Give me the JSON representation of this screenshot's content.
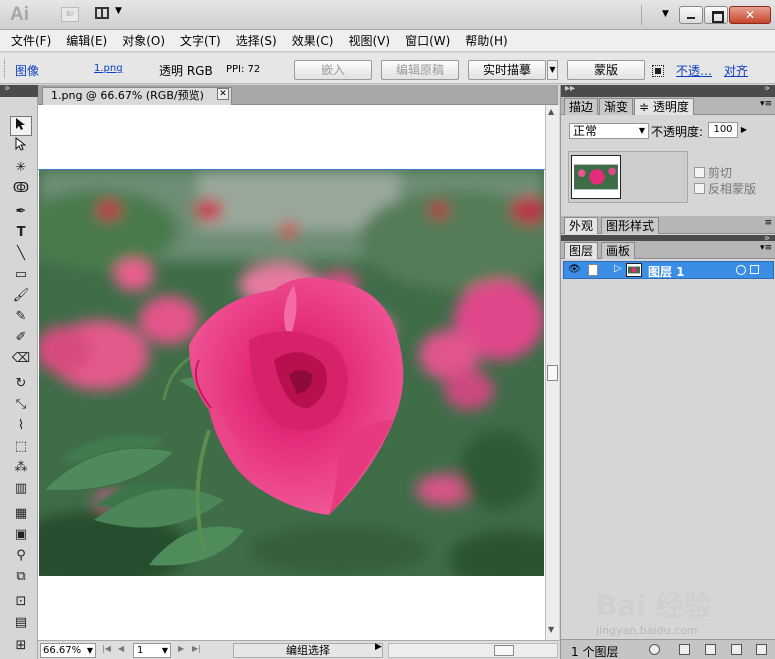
{
  "titlebar": {
    "app_logo": "Ai",
    "bridge": "Br",
    "close": "✕"
  },
  "menu": [
    "文件(F)",
    "编辑(E)",
    "对象(O)",
    "文字(T)",
    "选择(S)",
    "效果(C)",
    "视图(V)",
    "窗口(W)",
    "帮助(H)"
  ],
  "control": {
    "object_type": "图像",
    "filename": "1.png",
    "transparency": "透明 RGB",
    "ppi": "PPI: 72",
    "embed": "嵌入",
    "edit_original": "编辑原稿",
    "live_trace": "实时描摹",
    "mask": "蒙版",
    "opacity_link": "不透…",
    "align_link": "对齐"
  },
  "document": {
    "tab_title": "1.png @ 66.67% (RGB/预览)",
    "close": "✕"
  },
  "status": {
    "zoom": "66.67%",
    "page": "1",
    "status_text": "编组选择"
  },
  "panels": {
    "top_tabs": [
      "描边",
      "渐变",
      "≑ 透明度"
    ],
    "blend_mode": "正常",
    "opacity_label": "不透明度:",
    "opacity_value": "100",
    "clip": "剪切",
    "invert_mask": "反相蒙版",
    "mid_tabs": [
      "外观",
      "图形样式"
    ],
    "layer_tabs": [
      "图层",
      "画板"
    ],
    "layer_name": "图层 1",
    "layer_count": "1 个图层"
  },
  "watermark": {
    "logo": "Bai 经验",
    "url": "jingyan.baidu.com"
  },
  "colors": {
    "accent": "#3a8ee6",
    "link": "#0d3ec2",
    "rose": "#e8206e"
  }
}
